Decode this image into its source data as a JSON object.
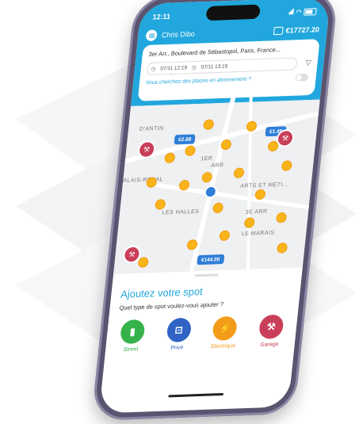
{
  "status": {
    "time": "12:11"
  },
  "header": {
    "user_name": "Chris Dibo",
    "balance": "€17727.20"
  },
  "search": {
    "address": "3er Arr., Boulevard de Sébastopol, Paris, France...",
    "start": "07/11 12:19",
    "end": "07/11 13:19",
    "subscription_question": "Vous cherchez des places en abonnement ?"
  },
  "map": {
    "labels": {
      "antin": "D'ANTIN",
      "arr1": "1ER",
      "arr2": "ARR",
      "royal": "ALAIS-ROYAL",
      "arts": "ARTS ET MÉTI...",
      "halles": "LES HALLES",
      "arr3": "3E ARR",
      "marais": "LE MARAIS"
    },
    "prices": {
      "p1": "€2.88",
      "p2": "€1.45",
      "p3": "€144.00"
    }
  },
  "add_spot": {
    "title": "Ajoutez votre spot",
    "subtitle": "Quel type de spot voulez-vous ajouter ?",
    "types": [
      {
        "label": "Street",
        "color": "#35b34a"
      },
      {
        "label": "Privé",
        "color": "#2f63c4"
      },
      {
        "label": "Electrique",
        "color": "#f39c19"
      },
      {
        "label": "Garage",
        "color": "#c93f5a"
      }
    ]
  }
}
